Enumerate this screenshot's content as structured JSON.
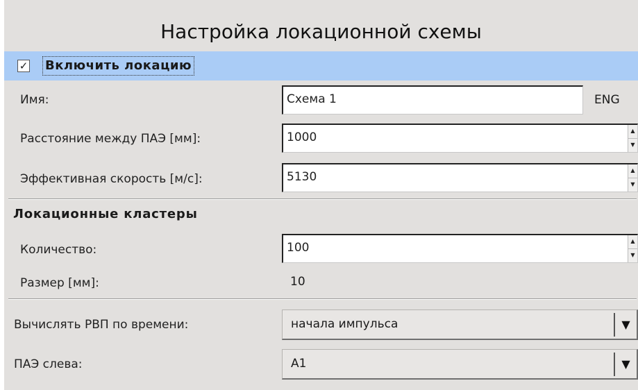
{
  "title": "Настройка локационной схемы",
  "enable": {
    "checked": true,
    "check_glyph": "✓",
    "label": "Включить локацию"
  },
  "fields": {
    "name": {
      "label": "Имя:",
      "value": "Схема 1",
      "lang": "ENG"
    },
    "distance": {
      "label": "Расстояние между ПАЭ [мм]:",
      "value": "1000"
    },
    "speed": {
      "label": "Эффективная скорость [м/с]:",
      "value": "5130"
    }
  },
  "clusters": {
    "title": "Локационные кластеры",
    "count": {
      "label": "Количество:",
      "value": "100"
    },
    "size": {
      "label": "Размер [мм]:",
      "value": "10"
    }
  },
  "compute": {
    "label": "Вычислять РВП по времени:",
    "value": "начала импульса"
  },
  "left_sensor": {
    "label": "ПАЭ слева:",
    "value": "A1"
  },
  "icons": {
    "spin_up": "▲",
    "spin_down": "▼",
    "combo_arrow": "▼"
  }
}
